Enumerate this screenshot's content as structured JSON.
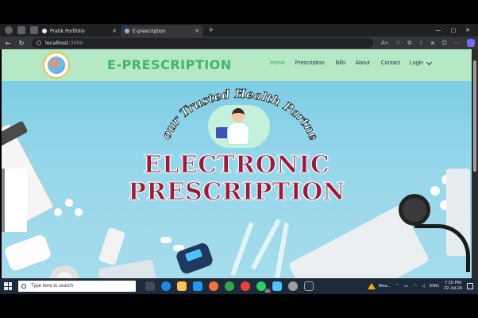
{
  "browser": {
    "tabs": [
      {
        "label": "Pratik Portfolio",
        "active": false
      },
      {
        "label": "E-prescription",
        "active": true
      }
    ],
    "url_host": "localhost",
    "url_port": ":3000"
  },
  "site": {
    "brand": "E-PRESCRIPTION",
    "nav": {
      "home": "Home",
      "prescription": "Prescription",
      "bills": "Bills",
      "about": "About",
      "contact": "Contact",
      "login": "Login"
    },
    "colors": {
      "navbar": "#b5e8c4",
      "brand": "#46b36d",
      "title": "#9b1b3b",
      "hero": "#95d6ea"
    }
  },
  "hero": {
    "tagline": "Your Trusted Health Partner",
    "title_line1": "ELECTRONIC",
    "title_line2": "PRESCRIPTION"
  },
  "taskbar": {
    "search_placeholder": "Type here to search",
    "badge_count": "22",
    "weather": "Wea...",
    "language": "ENG",
    "time": "7:15 PM",
    "date": "22-Jul-24"
  }
}
